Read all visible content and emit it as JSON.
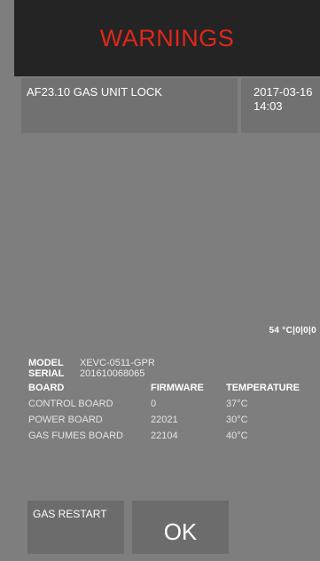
{
  "header": {
    "title": "WARNINGS",
    "title_color": "#e0271a"
  },
  "warning": {
    "message": "AF23.10 GAS UNIT LOCK",
    "date": "2017-03-16",
    "time": "14:03"
  },
  "status_readout": "54 °C|0|0|0",
  "unit_info": {
    "model_label": "MODEL",
    "model_value": "XEVC-0511-GPR",
    "serial_label": "SERIAL",
    "serial_value": "201610068065"
  },
  "boards_table": {
    "headers": [
      "BOARD",
      "FIRMWARE",
      "TEMPERATURE"
    ],
    "rows": [
      [
        "CONTROL BOARD",
        "0",
        "37°C"
      ],
      [
        "POWER BOARD",
        "22021",
        "30°C"
      ],
      [
        "GAS FUMES BOARD",
        "22104",
        "40°C"
      ]
    ]
  },
  "buttons": {
    "gas_restart": "GAS RESTART",
    "ok": "OK"
  }
}
